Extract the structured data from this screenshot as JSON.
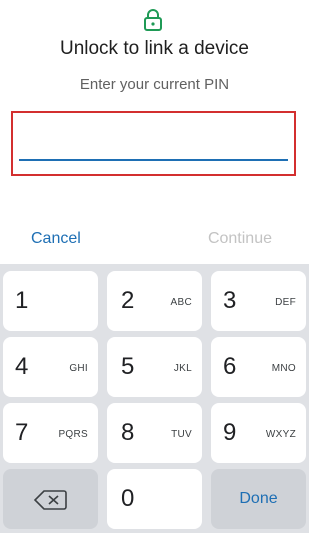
{
  "dialog": {
    "title": "Unlock to link a device",
    "subtitle": "Enter your current PIN",
    "pin_value": "",
    "cancel_label": "Cancel",
    "continue_label": "Continue"
  },
  "keyboard": {
    "keys": [
      {
        "num": "1",
        "letters": ""
      },
      {
        "num": "2",
        "letters": "ABC"
      },
      {
        "num": "3",
        "letters": "DEF"
      },
      {
        "num": "4",
        "letters": "GHI"
      },
      {
        "num": "5",
        "letters": "JKL"
      },
      {
        "num": "6",
        "letters": "MNO"
      },
      {
        "num": "7",
        "letters": "PQRS"
      },
      {
        "num": "8",
        "letters": "TUV"
      },
      {
        "num": "9",
        "letters": "WXYZ"
      }
    ],
    "zero": "0",
    "done_label": "Done",
    "icons": {
      "lock": "lock-icon",
      "backspace": "backspace-icon"
    }
  },
  "colors": {
    "accent": "#1e6fb4",
    "highlight_border": "#d32f2f",
    "disabled_text": "#c3c3c3",
    "keyboard_bg": "#dfe1e5"
  }
}
